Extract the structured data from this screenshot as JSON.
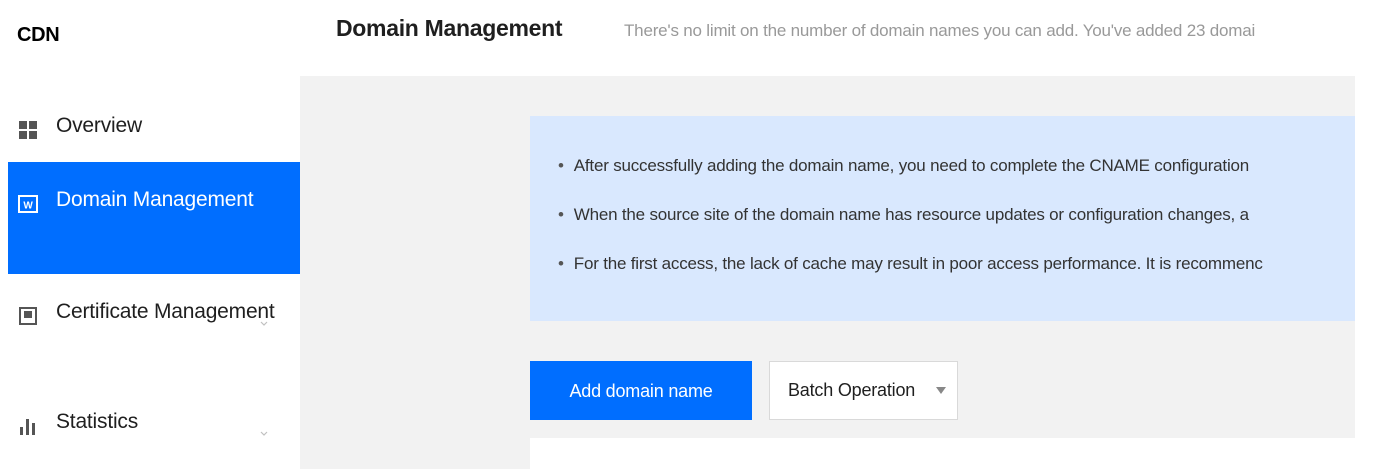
{
  "sidebar": {
    "brand": "CDN",
    "items": [
      {
        "label": "Overview",
        "icon": "grid-icon"
      },
      {
        "label": "Domain Management",
        "icon": "web-icon",
        "active": true
      },
      {
        "label": "Certificate Management",
        "icon": "certificate-icon",
        "has_submenu": true
      },
      {
        "label": "Statistics",
        "icon": "bar-chart-icon",
        "has_submenu": true
      }
    ]
  },
  "header": {
    "title": "Domain Management",
    "description": "There's no limit on the number of domain names you can add. You've added 23 domai"
  },
  "notice": {
    "items": [
      "After successfully adding the domain name, you need to complete the CNAME configuration",
      "When the source site of the domain name has resource updates or configuration changes, a",
      "For the first access, the lack of cache may result in poor access performance. It is recommenc"
    ]
  },
  "actions": {
    "add_label": "Add domain name",
    "batch_label": "Batch Operation"
  },
  "colors": {
    "accent": "#006eff",
    "notice_bg": "#d9e8fe",
    "content_bg": "#f2f2f2"
  }
}
